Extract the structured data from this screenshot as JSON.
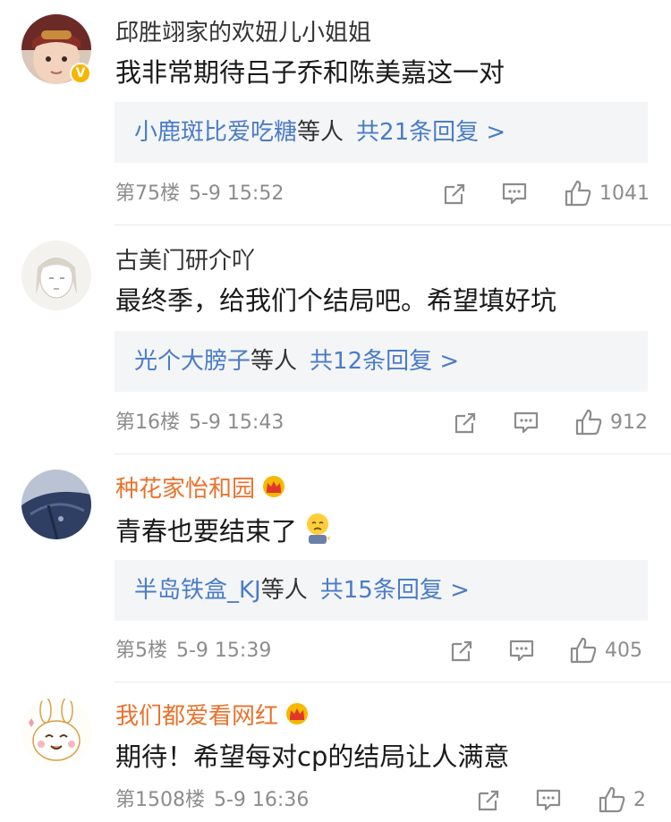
{
  "comments": [
    {
      "username": "邱胜翊家的欢妞儿小姐姐",
      "text": "我非常期待吕子乔和陈美嘉这一对",
      "replies_names": "小鹿斑比爱吃糖",
      "replies_suffix": "等人",
      "replies_count": "共21条回复 >",
      "floor": "第75楼",
      "time": "5-9 15:52",
      "likes": "1041",
      "verified": "V",
      "avatar": "child-avatar",
      "crown": false
    },
    {
      "username": "古美门研介吖",
      "text": "最终季，给我们个结局吧。希望填好坑",
      "replies_names": "光个大膀子",
      "replies_suffix": "等人",
      "replies_count": "共12条回复 >",
      "floor": "第16楼",
      "time": "5-9 15:43",
      "likes": "912",
      "avatar": "sketch-avatar",
      "crown": false
    },
    {
      "username": "种花家怡和园",
      "text": "青春也要结束了",
      "replies_names": "半岛铁盒_KJ",
      "replies_suffix": "等人",
      "replies_count": "共15条回复 >",
      "floor": "第5楼",
      "time": "5-9 15:39",
      "likes": "405",
      "avatar": "jacket-avatar",
      "crown": true,
      "emoji": "sad-emoji"
    },
    {
      "username": "我们都爱看网红",
      "text": "期待！希望每对cp的结局让人满意",
      "floor": "第1508楼",
      "time": "5-9 16:36",
      "likes": "2",
      "avatar": "bunny-avatar",
      "crown": true
    }
  ],
  "colors": {
    "vip_name": "#e9722b",
    "reply_link": "#4a7cc7",
    "meta": "#8c8c8c",
    "reply_bg": "#f4f5f7"
  },
  "icons": [
    "share-icon",
    "comment-icon",
    "like-icon",
    "crown-icon",
    "verified-badge"
  ]
}
